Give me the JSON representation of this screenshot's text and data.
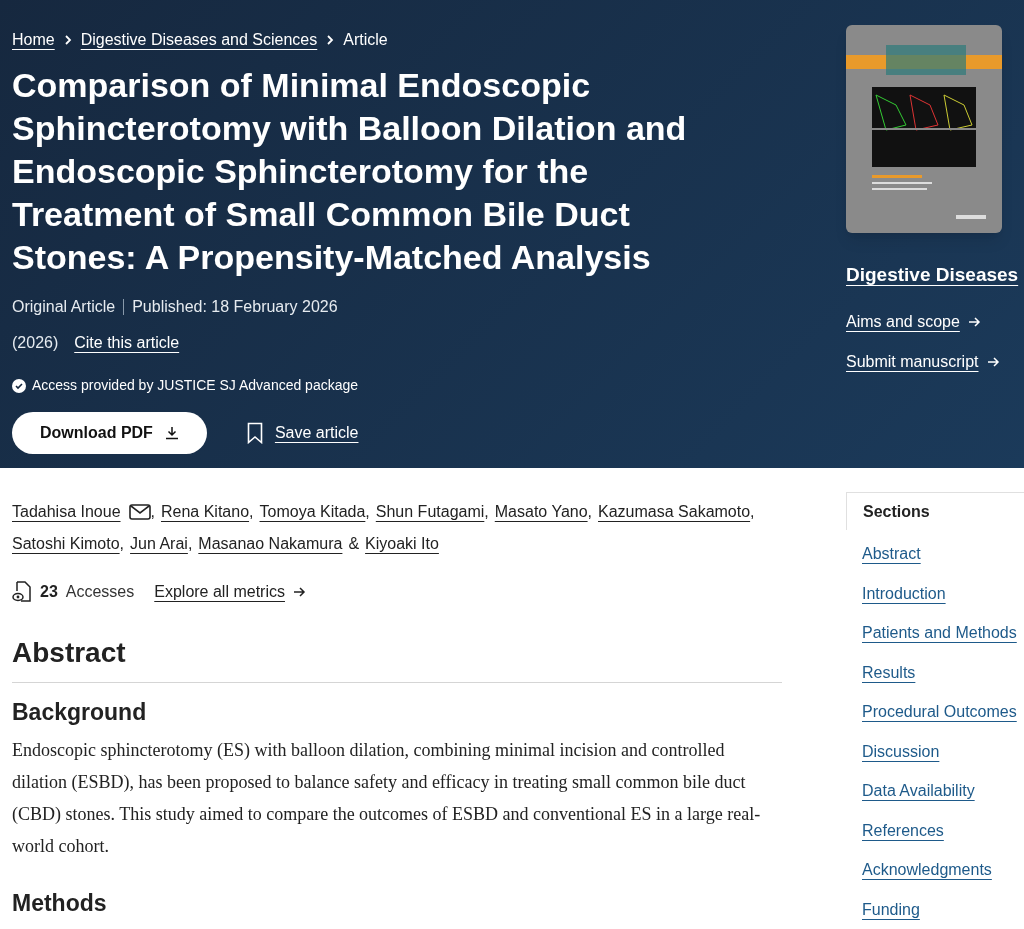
{
  "breadcrumb": [
    {
      "label": "Home",
      "current": false
    },
    {
      "label": "Digestive Diseases and Sciences",
      "current": false
    },
    {
      "label": "Article",
      "current": true
    }
  ],
  "title": "Comparison of Minimal Endoscopic Sphincterotomy with Balloon Dilation and Endoscopic Sphincterotomy for the Treatment of Small Common Bile Duct Stones: A Propensity-Matched Analysis",
  "article_type": "Original Article",
  "published": "Published: 18 February 2026",
  "year": "(2026)",
  "cite_link": "Cite this article",
  "access_note": "Access provided by JUSTICE SJ Advanced package",
  "download_button": "Download PDF",
  "save_button": "Save article",
  "journal": {
    "cover": {
      "kind": "picture"
    },
    "name": "Digestive Diseases",
    "links": [
      "Aims and scope",
      "Submit manuscript"
    ]
  },
  "authors": [
    {
      "name": "Tadahisa Inoue",
      "email": true,
      "sep": ","
    },
    {
      "name": "Rena Kitano",
      "email": false,
      "sep": ","
    },
    {
      "name": "Tomoya Kitada",
      "email": false,
      "sep": ","
    },
    {
      "name": "Shun Futagami",
      "email": false,
      "sep": ","
    },
    {
      "name": "Masato Yano",
      "email": false,
      "sep": ","
    },
    {
      "name": "Kazumasa Sakamoto",
      "email": false,
      "sep": ","
    },
    {
      "name": "Satoshi Kimoto",
      "email": false,
      "sep": ","
    },
    {
      "name": "Jun Arai",
      "email": false,
      "sep": ","
    },
    {
      "name": "Masanao Nakamura",
      "email": false,
      "sep": "&"
    },
    {
      "name": "Kiyoaki Ito",
      "email": false
    }
  ],
  "metrics": {
    "count": "23",
    "label": "Accesses",
    "link": "Explore all metrics"
  },
  "abstract": {
    "heading": "Abstract",
    "sections": [
      {
        "heading": "Background",
        "text": "Endoscopic sphincterotomy (ES) with balloon dilation, combining minimal incision and controlled dilation (ESBD), has been proposed to balance safety and efficacy in treating small common bile duct (CBD) stones. This study aimed to compare the outcomes of ESBD and conventional ES in a large real-world cohort."
      },
      {
        "heading": "Methods"
      }
    ]
  },
  "sections_nav": {
    "title": "Sections",
    "items": [
      "Abstract",
      "Introduction",
      "Patients and Methods",
      "Results",
      "Procedural Outcomes",
      "Discussion",
      "Data Availability",
      "References",
      "Acknowledgments",
      "Funding"
    ]
  }
}
